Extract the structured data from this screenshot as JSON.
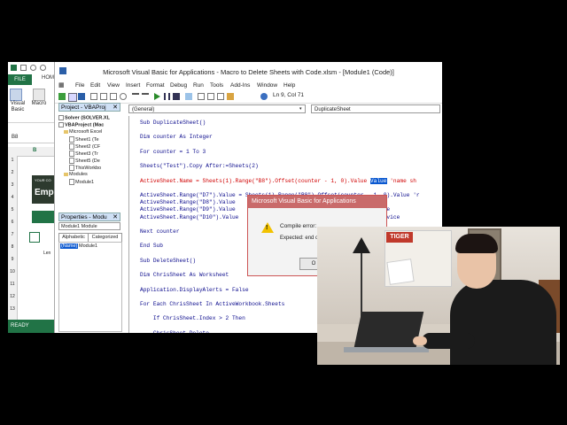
{
  "excel": {
    "file_tab": "FILE",
    "home_tab": "HOM",
    "ribbon_btn1": "Visual\nBasic",
    "ribbon_btn2": "Macro",
    "name_box": "B8",
    "banner_small": "YOUR CO",
    "banner_big": "Emp",
    "row_numbers": [
      "1",
      "2",
      "3",
      "4",
      "5",
      "6",
      "7",
      "8",
      "9",
      "10",
      "11",
      "12",
      "13"
    ],
    "cell_text": "Len",
    "status": "READY"
  },
  "vbe": {
    "title": "Microsoft Visual Basic for Applications - Macro to Delete Sheets with Code.xlsm - [Module1 (Code)]",
    "menu": [
      "File",
      "Edit",
      "View",
      "Insert",
      "Format",
      "Debug",
      "Run",
      "Tools",
      "Add-Ins",
      "Window",
      "Help"
    ],
    "position": "Ln 9, Col 71",
    "project_pane": {
      "title": "Project - VBAProj",
      "nodes": [
        {
          "label": "Solver (SOLVER.XL",
          "type": "project"
        },
        {
          "label": "VBAProject (Mac",
          "type": "project"
        },
        {
          "label": "Microsoft Excel",
          "type": "folder"
        },
        {
          "label": "Sheet1 (Te",
          "type": "sheet"
        },
        {
          "label": "Sheet2 (CF",
          "type": "sheet"
        },
        {
          "label": "Sheet3 (Tr",
          "type": "sheet"
        },
        {
          "label": "Sheet5 (De",
          "type": "sheet"
        },
        {
          "label": "ThisWorkbo",
          "type": "sheet"
        },
        {
          "label": "Modules",
          "type": "folder"
        },
        {
          "label": "Module1",
          "type": "module"
        }
      ]
    },
    "properties_pane": {
      "title": "Properties - Modu",
      "selector": "Module1 Module",
      "tabs": [
        "Alphabetic",
        "Categorized"
      ],
      "row_name": "(Name)",
      "row_value": "Module1"
    },
    "object_combo": "(General)",
    "proc_combo": "DuplicateSheet",
    "code_lines": [
      {
        "text": "Sub DuplicateSheet()",
        "style": "normal"
      },
      {
        "text": "",
        "style": "normal"
      },
      {
        "text": "Dim counter As Integer",
        "style": "normal"
      },
      {
        "text": "",
        "style": "normal"
      },
      {
        "text": "For counter = 1 To 3",
        "style": "normal"
      },
      {
        "text": "",
        "style": "normal"
      },
      {
        "text": "Sheets(\"Test\").Copy After:=Sheets(2)",
        "style": "normal"
      },
      {
        "text": "",
        "style": "normal"
      },
      {
        "text": "ActiveSheet.Name = Sheets(1).Range(\"B8\").Offset(counter - 1, 0).Value ",
        "style": "red",
        "hl": "Value",
        "tail": " 'name sh"
      },
      {
        "text": "",
        "style": "normal"
      },
      {
        "text": "ActiveSheet.Range(\"D7\").Value = Sheets(1).Range(\"B8\").Offset(counter - 1, 0).Value 'r",
        "style": "normal"
      },
      {
        "text": "ActiveSheet.Range(\"D8\").Value",
        "style": "normal",
        "tail2": "te"
      },
      {
        "text": "ActiveSheet.Range(\"D9\").Value",
        "style": "normal",
        "tail2": "ate"
      },
      {
        "text": "ActiveSheet.Range(\"D10\").Value",
        "style": "normal",
        "tail2": "ervice"
      },
      {
        "text": "",
        "style": "normal"
      },
      {
        "text": "Next counter",
        "style": "normal"
      },
      {
        "text": "",
        "style": "normal"
      },
      {
        "text": "End Sub",
        "style": "normal"
      },
      {
        "text": "",
        "style": "normal"
      },
      {
        "text": "Sub DeleteSheet()",
        "style": "normal"
      },
      {
        "text": "",
        "style": "normal"
      },
      {
        "text": "Dim ChrisSheet As Worksheet",
        "style": "normal"
      },
      {
        "text": "",
        "style": "normal"
      },
      {
        "text": "Application.DisplayAlerts = False",
        "style": "normal"
      },
      {
        "text": "",
        "style": "normal"
      },
      {
        "text": "For Each ChrisSheet In ActiveWorkbook.Sheets",
        "style": "normal"
      },
      {
        "text": "",
        "style": "normal"
      },
      {
        "text": "    If ChrisSheet.Index > 2 Then",
        "style": "normal"
      },
      {
        "text": "",
        "style": "normal"
      },
      {
        "text": "    ChrisSheet.Delete",
        "style": "normal"
      }
    ]
  },
  "dialog": {
    "title": "Microsoft Visual Basic for Applications",
    "line1": "Compile error:",
    "line2": "Expected: end of",
    "button": "O"
  },
  "webcam": {
    "sign": "TIGER"
  }
}
